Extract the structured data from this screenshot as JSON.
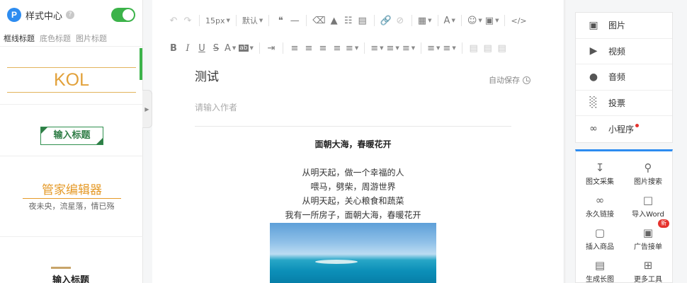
{
  "left": {
    "logo_letter": "P",
    "title": "样式中心",
    "help": "?",
    "tabs": [
      "框线标题",
      "底色标题",
      "图片标题"
    ],
    "styles": {
      "kol": "KOL",
      "input_title_1": "输入标题",
      "manager_title": "管家编辑器",
      "manager_sub": "夜未央，流星落，情已殇",
      "input_title_2": "输入标题"
    }
  },
  "toolbar": {
    "font_size": "15px",
    "font_family": "默认"
  },
  "editor": {
    "title": "测试",
    "autosave": "自动保存",
    "author_placeholder": "请输入作者",
    "heading": "面朝大海，春暖花开",
    "lines": [
      "从明天起，做一个幸福的人",
      "喂马，劈柴，周游世界",
      "从明天起，关心粮食和蔬菜",
      "我有一所房子，面朝大海，春暖花开"
    ]
  },
  "right": {
    "media": [
      {
        "label": "图片",
        "icon": "image-icon"
      },
      {
        "label": "视频",
        "icon": "video-icon"
      },
      {
        "label": "音频",
        "icon": "microphone-icon"
      },
      {
        "label": "投票",
        "icon": "vote-icon"
      },
      {
        "label": "小程序",
        "icon": "miniprogram-icon"
      }
    ],
    "tools": [
      {
        "label": "图文采集",
        "icon": "download-icon"
      },
      {
        "label": "图片搜索",
        "icon": "search-icon"
      },
      {
        "label": "永久链接",
        "icon": "link-icon"
      },
      {
        "label": "导入Word",
        "icon": "word-icon"
      },
      {
        "label": "插入商品",
        "icon": "shopping-bag-icon"
      },
      {
        "label": "广告接单",
        "icon": "ad-image-icon"
      },
      {
        "label": "生成长图",
        "icon": "long-image-icon"
      },
      {
        "label": "更多工具",
        "icon": "grid-icon"
      }
    ],
    "new_badge": "新"
  }
}
